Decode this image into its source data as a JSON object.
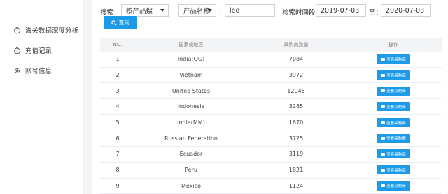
{
  "sidebar": {
    "items": [
      {
        "label": "海关数据深度分析",
        "icon": "piggy-bank-icon"
      },
      {
        "label": "充值记录",
        "icon": "coin-icon"
      },
      {
        "label": "账号信息",
        "icon": "gear-icon"
      }
    ]
  },
  "search": {
    "search_label": "搜索：",
    "mode_value": "按产品搜",
    "field_value": "产品名称",
    "colon": ":",
    "keyword_value": "led",
    "time_label": "检索时间段：",
    "start_date": "2019-07-03",
    "to_label": "至：",
    "end_date": "2020-07-03",
    "query_button": "查询"
  },
  "table": {
    "headers": [
      "NO.",
      "国家或地区",
      "采购商数量",
      "操作"
    ],
    "action_label": "查看采购商",
    "rows": [
      {
        "no": "1",
        "country": "India(QG)",
        "count": "7084"
      },
      {
        "no": "2",
        "country": "Vietnam",
        "count": "3972"
      },
      {
        "no": "3",
        "country": "United States",
        "count": "12046"
      },
      {
        "no": "4",
        "country": "Indonesia",
        "count": "3285"
      },
      {
        "no": "5",
        "country": "India(MM)",
        "count": "1670"
      },
      {
        "no": "6",
        "country": "Russian Federation",
        "count": "3725"
      },
      {
        "no": "7",
        "country": "Ecuador",
        "count": "3119"
      },
      {
        "no": "8",
        "country": "Peru",
        "count": "1821"
      },
      {
        "no": "9",
        "country": "Mexico",
        "count": "1124"
      }
    ]
  },
  "colors": {
    "accent": "#1e9be8",
    "header_bg": "#f3f4f6"
  }
}
